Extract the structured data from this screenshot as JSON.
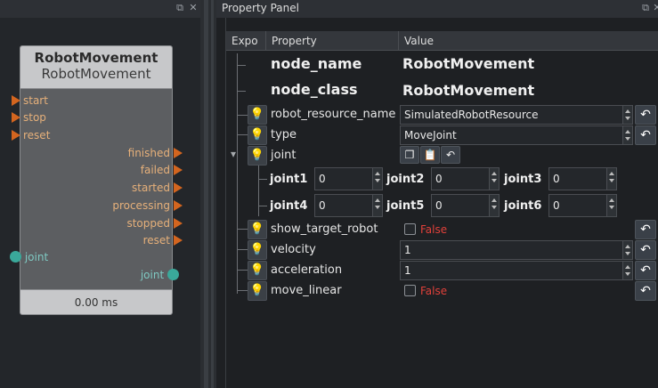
{
  "left_pane": {
    "node": {
      "title": "RobotMovement",
      "subtitle": "RobotMovement",
      "inputs": [
        "start",
        "stop",
        "reset"
      ],
      "outputs": [
        "finished",
        "failed",
        "started",
        "processing",
        "stopped",
        "reset"
      ],
      "data_input": "joint",
      "data_output": "joint",
      "timing": "0.00 ms"
    }
  },
  "property_panel": {
    "title": "Property Panel",
    "columns": {
      "expo": "Expo",
      "property": "Property",
      "value": "Value"
    },
    "node_name": {
      "label": "node_name",
      "value": "RobotMovement"
    },
    "node_class": {
      "label": "node_class",
      "value": "RobotMovement"
    },
    "robot_resource_name": {
      "label": "robot_resource_name",
      "value": "SimulatedRobotResource"
    },
    "type": {
      "label": "type",
      "value": "MoveJoint"
    },
    "joint": {
      "label": "joint",
      "joints": [
        {
          "label": "joint1",
          "value": "0"
        },
        {
          "label": "joint2",
          "value": "0"
        },
        {
          "label": "joint3",
          "value": "0"
        },
        {
          "label": "joint4",
          "value": "0"
        },
        {
          "label": "joint5",
          "value": "0"
        },
        {
          "label": "joint6",
          "value": "0"
        }
      ]
    },
    "show_target_robot": {
      "label": "show_target_robot",
      "value": "False"
    },
    "velocity": {
      "label": "velocity",
      "value": "1"
    },
    "acceleration": {
      "label": "acceleration",
      "value": "1"
    },
    "move_linear": {
      "label": "move_linear",
      "value": "False"
    }
  },
  "icons": {
    "bulb": "💡",
    "reset": "↶",
    "copy": "❐",
    "paste": "📋",
    "undo": "↶",
    "float": "⧉",
    "close": "✕",
    "expand": "▾"
  },
  "colors": {
    "accent_orange": "#d3651f",
    "data_teal": "#3aa89a",
    "false_red": "#e0403a"
  }
}
